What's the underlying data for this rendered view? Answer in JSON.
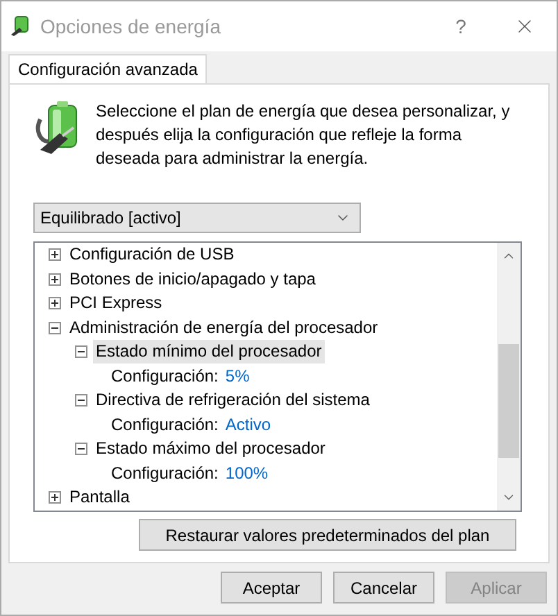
{
  "window": {
    "title": "Opciones de energía",
    "help": "?"
  },
  "tabs": [
    {
      "label": "Configuración avanzada",
      "selected": true
    }
  ],
  "description": "Seleccione el plan de energía que desea personalizar, y después elija la configuración que refleje la forma deseada para administrar la energía.",
  "plan_dropdown": {
    "value": "Equilibrado [activo]"
  },
  "tree": [
    {
      "kind": "group",
      "label": "Configuración de USB",
      "expanded": false,
      "selected": false
    },
    {
      "kind": "group",
      "label": "Botones de inicio/apagado y tapa",
      "expanded": false,
      "selected": false
    },
    {
      "kind": "group",
      "label": "PCI Express",
      "expanded": false,
      "selected": false
    },
    {
      "kind": "group",
      "label": "Administración de energía del procesador",
      "expanded": true,
      "selected": false,
      "children": [
        {
          "kind": "group",
          "label": "Estado mínimo del procesador",
          "expanded": true,
          "selected": true,
          "children": [
            {
              "kind": "setting",
              "label": "Configuración:",
              "value": "5%"
            }
          ]
        },
        {
          "kind": "group",
          "label": "Directiva de refrigeración del sistema",
          "expanded": true,
          "selected": false,
          "children": [
            {
              "kind": "setting",
              "label": "Configuración:",
              "value": "Activo"
            }
          ]
        },
        {
          "kind": "group",
          "label": "Estado máximo del procesador",
          "expanded": true,
          "selected": false,
          "children": [
            {
              "kind": "setting",
              "label": "Configuración:",
              "value": "100%"
            }
          ]
        }
      ]
    },
    {
      "kind": "group",
      "label": "Pantalla",
      "expanded": false,
      "selected": false
    }
  ],
  "restore_button": "Restaurar valores predeterminados del plan",
  "buttons": [
    {
      "label": "Aceptar",
      "disabled": false
    },
    {
      "label": "Cancelar",
      "disabled": false
    },
    {
      "label": "Aplicar",
      "disabled": true
    }
  ]
}
